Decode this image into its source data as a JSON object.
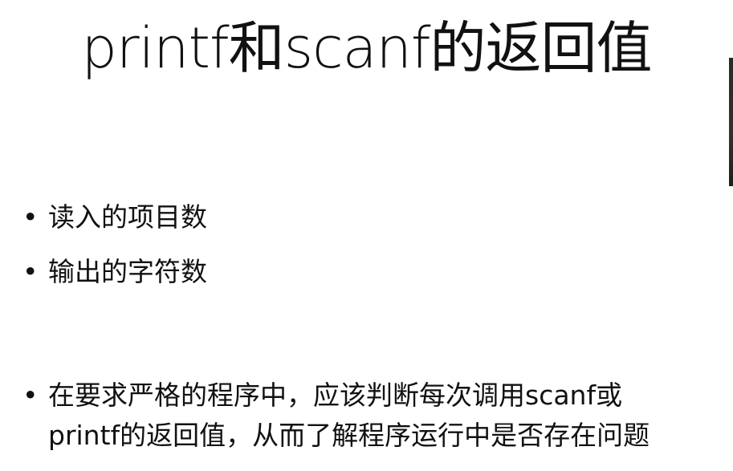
{
  "slide": {
    "title": "printf和scanf的返回值",
    "bullets": [
      {
        "symbol": "•",
        "lines": [
          "读入的项目数"
        ]
      },
      {
        "symbol": "•",
        "lines": [
          "输出的字符数"
        ]
      },
      {
        "symbol": "•",
        "lines": [
          "在要求严格的程序中，应该判断每次调用scanf或",
          "printf的返回值，从而了解程序运行中是否存在问题"
        ]
      }
    ]
  }
}
